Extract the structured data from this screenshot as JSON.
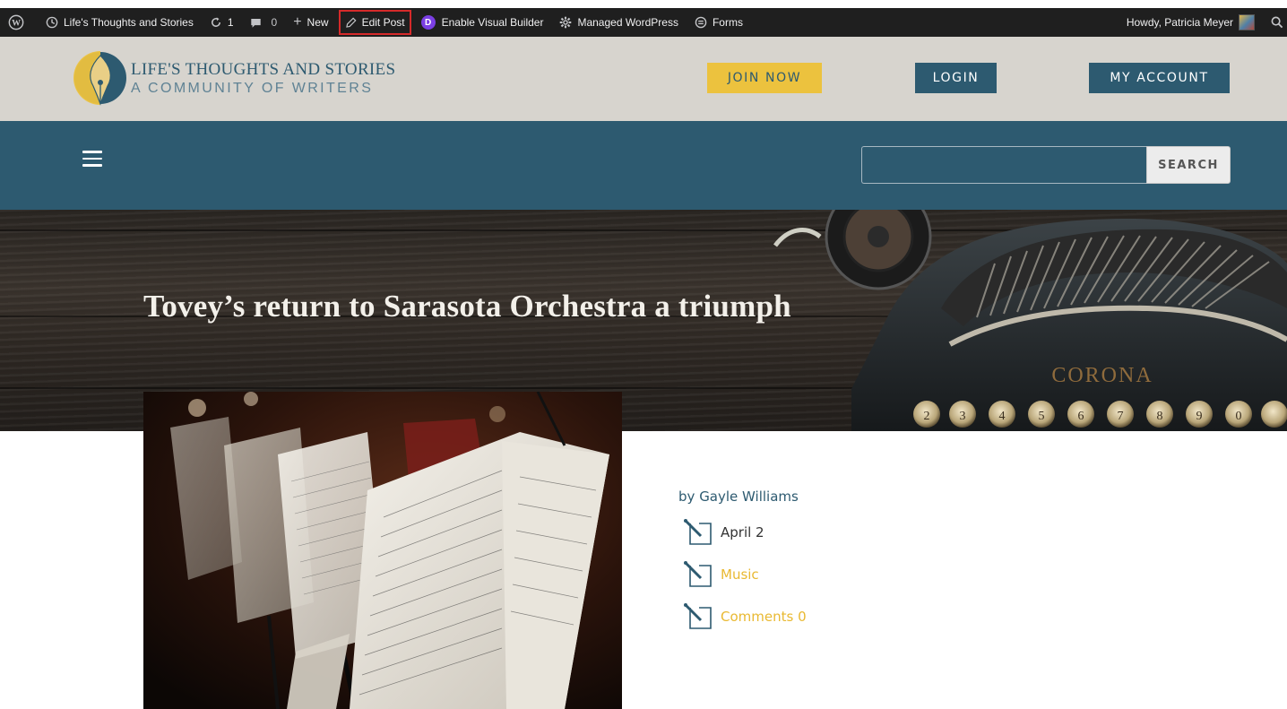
{
  "adminbar": {
    "site_name": "Life's Thoughts and Stories",
    "updates_count": "1",
    "comments_count": "0",
    "new_label": "New",
    "edit_post_label": "Edit Post",
    "divi_badge": "D",
    "visual_builder_label": "Enable Visual Builder",
    "managed_wp_label": "Managed WordPress",
    "forms_label": "Forms",
    "howdy_label": "Howdy, Patricia Meyer"
  },
  "header": {
    "logo_title": "LIFE'S THOUGHTS AND STORIES",
    "logo_tagline": "A COMMUNITY OF WRITERS",
    "join_label": "JOIN NOW",
    "login_label": "LOGIN",
    "account_label": "MY ACCOUNT"
  },
  "nav": {
    "search_value": "",
    "search_button": "SEARCH"
  },
  "hero": {
    "title": "Tovey’s return to Sarasota Orchestra a triumph",
    "typewriter_brand": "CORONA",
    "keys": [
      "2",
      "3",
      "4",
      "5",
      "6",
      "7",
      "8",
      "9",
      "0"
    ]
  },
  "post": {
    "byline_prefix": "by",
    "author": "Gayle Williams",
    "date": "April 2",
    "category": "Music",
    "comments": "Comments 0"
  },
  "colors": {
    "brand_blue": "#2d5a70",
    "accent_gold": "#ecc23e",
    "header_bg": "#d7d4ce",
    "adminbar_bg": "#1f1f1f",
    "edit_post_highlight": "#d62a2a"
  }
}
